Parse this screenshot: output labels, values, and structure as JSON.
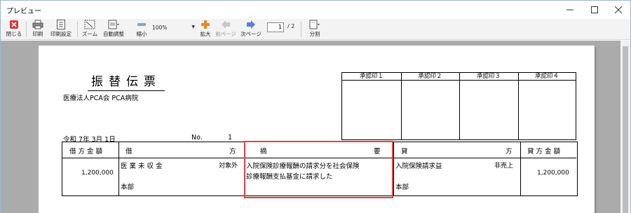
{
  "window": {
    "title": "プレビュー"
  },
  "toolbar": {
    "close_label": "閉じる",
    "print_label": "印刷",
    "print_settings_label": "印刷設定",
    "zoom_label": "ズーム",
    "auto_adjust_label": "自動調整",
    "shrink_label": "縮小",
    "zoom_value": "100%",
    "enlarge_label": "拡大",
    "prev_page_label": "前ページ",
    "next_page_label": "次ページ",
    "page_current": "1",
    "page_total": "/ 2",
    "split_label": "分割"
  },
  "voucher": {
    "title": "振替伝票",
    "company": "医療法人PCA会 PCA病院",
    "date": "令和 7年 3月 1日",
    "no_label": "No.",
    "no_value": "1",
    "approvals": [
      "承認印１",
      "承認印２",
      "承認印３",
      "承認印４"
    ],
    "headers": {
      "debit_amount": "借方金額",
      "debit_left": "借",
      "debit_right": "方",
      "summary_left": "摘",
      "summary_right": "要",
      "credit_left": "貸",
      "credit_right": "方",
      "credit_amount": "貸方金額"
    },
    "row": {
      "debit_amount": "1,200,000",
      "debit_account": "医 業 未 収 金",
      "debit_tax": "対象外",
      "debit_dept": "本部",
      "summary_line1": "入院保険診療報酬の請求分を社会保険",
      "summary_line2": "診療報酬支払基金に請求した",
      "credit_account": "入院保険請求益",
      "credit_tax": "非売上",
      "credit_dept": "本部",
      "credit_amount": "1,200,000"
    }
  },
  "colors": {
    "highlight": "#e8403c",
    "close_icon": "#d9363e",
    "arrow_icon": "#5b7fd6",
    "plus_icon": "#e38a1c"
  }
}
